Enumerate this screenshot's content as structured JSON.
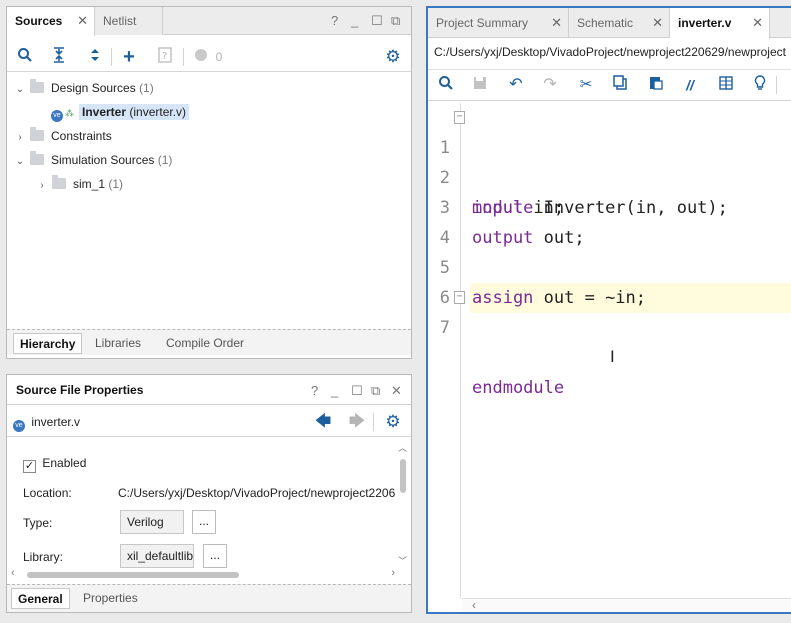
{
  "sources_panel": {
    "tabs": [
      {
        "label": "Sources",
        "active": true
      },
      {
        "label": "Netlist",
        "active": false
      }
    ],
    "toolbar": {
      "zero_count": "0"
    },
    "tree": [
      {
        "label": "Design Sources",
        "count": "(1)",
        "expanded": true
      },
      {
        "label": "Inverter",
        "detail": "(inverter.v)",
        "badge": "ve",
        "selected": true
      },
      {
        "label": "Constraints",
        "count": "",
        "expanded": false
      },
      {
        "label": "Simulation Sources",
        "count": "(1)",
        "expanded": true
      },
      {
        "label": "sim_1",
        "count": "(1)",
        "expanded": false
      }
    ],
    "bottom_tabs": [
      "Hierarchy",
      "Libraries",
      "Compile Order"
    ]
  },
  "props_panel": {
    "title": "Source File Properties",
    "file_name": "inverter.v",
    "file_badge": "ve",
    "enabled_label": "Enabled",
    "enabled_checked": true,
    "location_label": "Location:",
    "location_value": "C:/Users/yxj/Desktop/VivadoProject/newproject2206",
    "type_label": "Type:",
    "type_value": "Verilog",
    "library_label": "Library:",
    "library_value": "xil_defaultlib",
    "more": "...",
    "bottom_tabs": [
      "General",
      "Properties"
    ]
  },
  "editor": {
    "tabs": [
      {
        "label": "Project Summary",
        "active": false
      },
      {
        "label": "Schematic",
        "active": false
      },
      {
        "label": "inverter.v",
        "active": true
      }
    ],
    "path": "C:/Users/yxj/Desktop/VivadoProject/newproject220629/newproject",
    "lines": [
      {
        "num": "1",
        "kw": "module",
        "rest": " Inverter(in, out);"
      },
      {
        "num": "2",
        "kw": "input",
        "rest": " in;"
      },
      {
        "num": "3",
        "kw": "output",
        "rest": " out;"
      },
      {
        "num": "4",
        "kw": "",
        "rest": ""
      },
      {
        "num": "5",
        "kw": "assign",
        "rest": " out = ~in;"
      },
      {
        "num": "6",
        "kw": "",
        "rest": ""
      },
      {
        "num": "7",
        "kw": "endmodule",
        "rest": ""
      }
    ],
    "current_line_color": "#fffbdc",
    "keyword_color": "#7a2a95"
  },
  "colors": {
    "accent": "#1d5f9e",
    "editor_border": "#3a78c2"
  }
}
